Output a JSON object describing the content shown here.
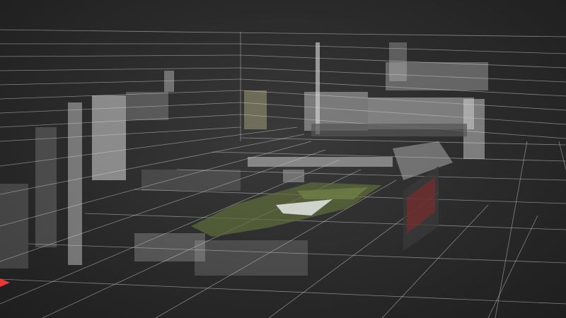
{
  "viewport": {
    "type": "3d-point-cloud-view",
    "background": "#2b2b2b",
    "grid_color": "#cfcfcf",
    "points_color": "#d8d8d8"
  },
  "icons": {
    "axis_gizmo": "axis-gizmo-icon"
  },
  "colors": {
    "axis_x": "#e53935",
    "grass": "#5f6d3c",
    "facade": "#bfbfbf",
    "sign_red": "#8d2a2a"
  }
}
